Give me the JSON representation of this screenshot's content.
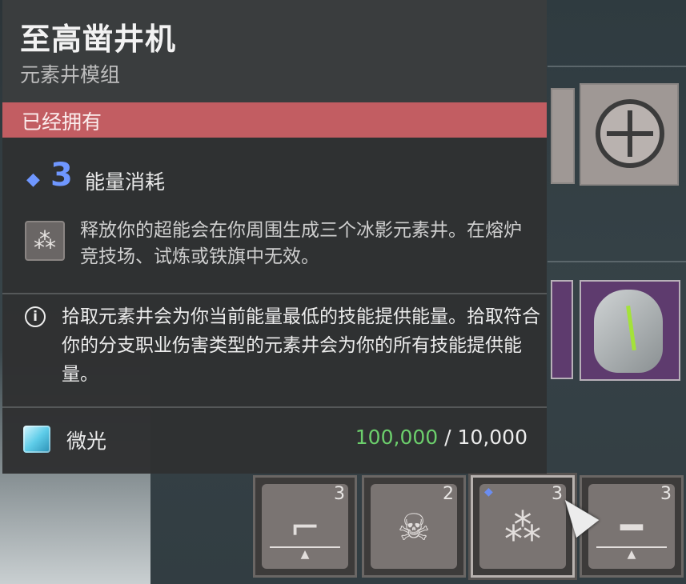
{
  "tooltip": {
    "title": "至高凿井机",
    "subtitle": "元素井模组",
    "status": "已经拥有",
    "energy": {
      "icon": "energy-diamond-icon",
      "cost": "3",
      "label": "能量消耗"
    },
    "perk": {
      "icon": "elemental-well-perk-icon",
      "description": "释放你的超能会在你周围生成三个冰影元素井。在熔炉竞技场、试炼或铁旗中无效。"
    },
    "info": {
      "icon": "info-icon",
      "text": "拾取元素井会为你当前能量最低的技能提供能量。拾取符合你的分支职业伤害类型的元素井会为你的所有技能提供能量。"
    },
    "cost": {
      "icon": "glimmer-icon",
      "label": "微光",
      "owned": "100,000",
      "separator": "/",
      "required": "10,000"
    }
  },
  "sockets": [
    {
      "cost": "3",
      "icon": "weapon-rifle-icon"
    },
    {
      "cost": "2",
      "icon": "skull-icon"
    },
    {
      "cost": "3",
      "icon": "elemental-well-icon"
    },
    {
      "cost": "3",
      "icon": "weapon-sniper-icon"
    }
  ],
  "colors": {
    "owned_banner": "#c25d62",
    "energy": "#6f97ff",
    "glimmer_owned": "#6ccf6c"
  }
}
